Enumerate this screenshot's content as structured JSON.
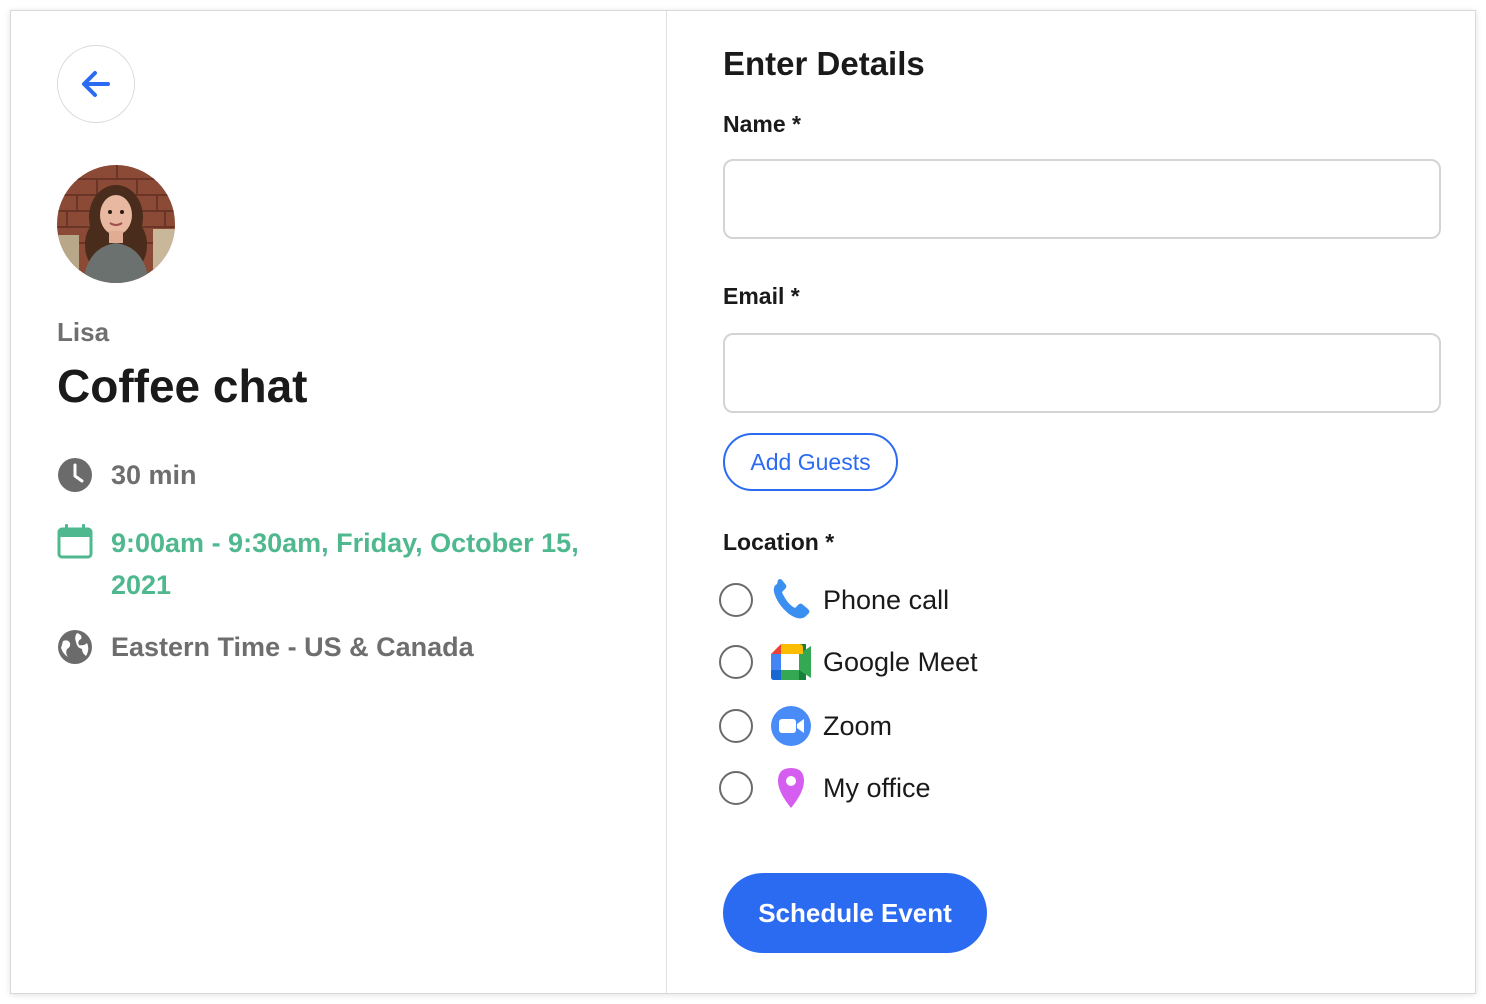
{
  "colors": {
    "primary": "#2b6bf2",
    "date_accent": "#4fb88f",
    "muted_text": "#6e6e6e",
    "heading": "#1a1a1a"
  },
  "event": {
    "host_name": "Lisa",
    "title": "Coffee chat",
    "duration": "30 min",
    "datetime": "9:00am - 9:30am, Friday, October 15, 2021",
    "timezone": "Eastern Time - US & Canada"
  },
  "form": {
    "title": "Enter Details",
    "name_label": "Name *",
    "name_value": "",
    "email_label": "Email *",
    "email_value": "",
    "add_guests_label": "Add Guests",
    "location_label": "Location *",
    "location_options": [
      {
        "label": "Phone call",
        "icon": "phone-icon",
        "selected": false
      },
      {
        "label": "Google Meet",
        "icon": "google-meet-icon",
        "selected": false
      },
      {
        "label": "Zoom",
        "icon": "zoom-icon",
        "selected": false
      },
      {
        "label": "My office",
        "icon": "map-pin-icon",
        "selected": false
      }
    ],
    "submit_label": "Schedule Event"
  }
}
